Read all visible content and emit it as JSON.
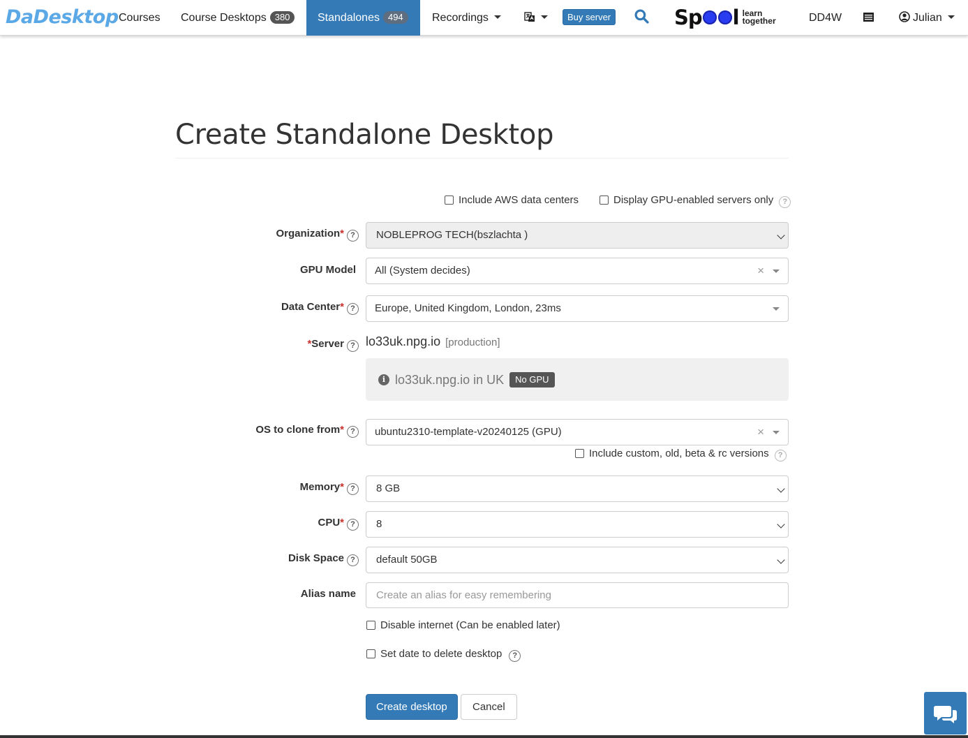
{
  "navbar": {
    "brand_part1": "Da",
    "brand_part2": "Desktop",
    "items": [
      {
        "label": "Courses"
      },
      {
        "label": "Course Desktops",
        "badge": "380"
      },
      {
        "label": "Standalones",
        "badge": "494",
        "active": true
      },
      {
        "label": "Recordings"
      }
    ],
    "language_icon": "language-icon",
    "buy_server": "Buy server",
    "search_icon": "search-icon",
    "spool": {
      "word_start": "Sp",
      "word_end": "l",
      "tagline_1": "learn",
      "tagline_2": "together"
    },
    "dd4w": "DD4W",
    "menu_icon": "list-icon",
    "user": "Julian"
  },
  "page": {
    "title": "Create Standalone Desktop"
  },
  "form": {
    "include_aws": "Include AWS data centers",
    "gpu_only": "Display GPU-enabled servers only",
    "organization": {
      "label": "Organization",
      "value": "NOBLEPROG TECH(bszlachta )"
    },
    "gpu_model": {
      "label": "GPU Model",
      "value": "All (System decides)"
    },
    "data_center": {
      "label": "Data Center",
      "value": "Europe, United Kingdom, London, 23ms"
    },
    "server": {
      "label": "Server",
      "value": "lo33uk.npg.io",
      "env": "[production]",
      "info": "lo33uk.npg.io in UK",
      "badge": "No GPU"
    },
    "os": {
      "label": "OS to clone from",
      "value": "ubuntu2310-template-v20240125 (GPU)",
      "include_versions": "Include custom, old, beta & rc versions"
    },
    "memory": {
      "label": "Memory",
      "value": "8 GB"
    },
    "cpu": {
      "label": "CPU",
      "value": "8"
    },
    "disk": {
      "label": "Disk Space",
      "value": "default 50GB"
    },
    "alias": {
      "label": "Alias name",
      "placeholder": "Create an alias for easy remembering"
    },
    "disable_internet": "Disable internet (Can be enabled later)",
    "set_delete_date": "Set date to delete desktop",
    "submit": "Create desktop",
    "cancel": "Cancel",
    "required_mark": "*",
    "help_glyph": "?",
    "clear_glyph": "×"
  },
  "chat_icon": "chat-bubbles-icon",
  "colors": {
    "primary": "#337ab7",
    "brand": "#5aa8e6",
    "required": "#c9302c"
  }
}
